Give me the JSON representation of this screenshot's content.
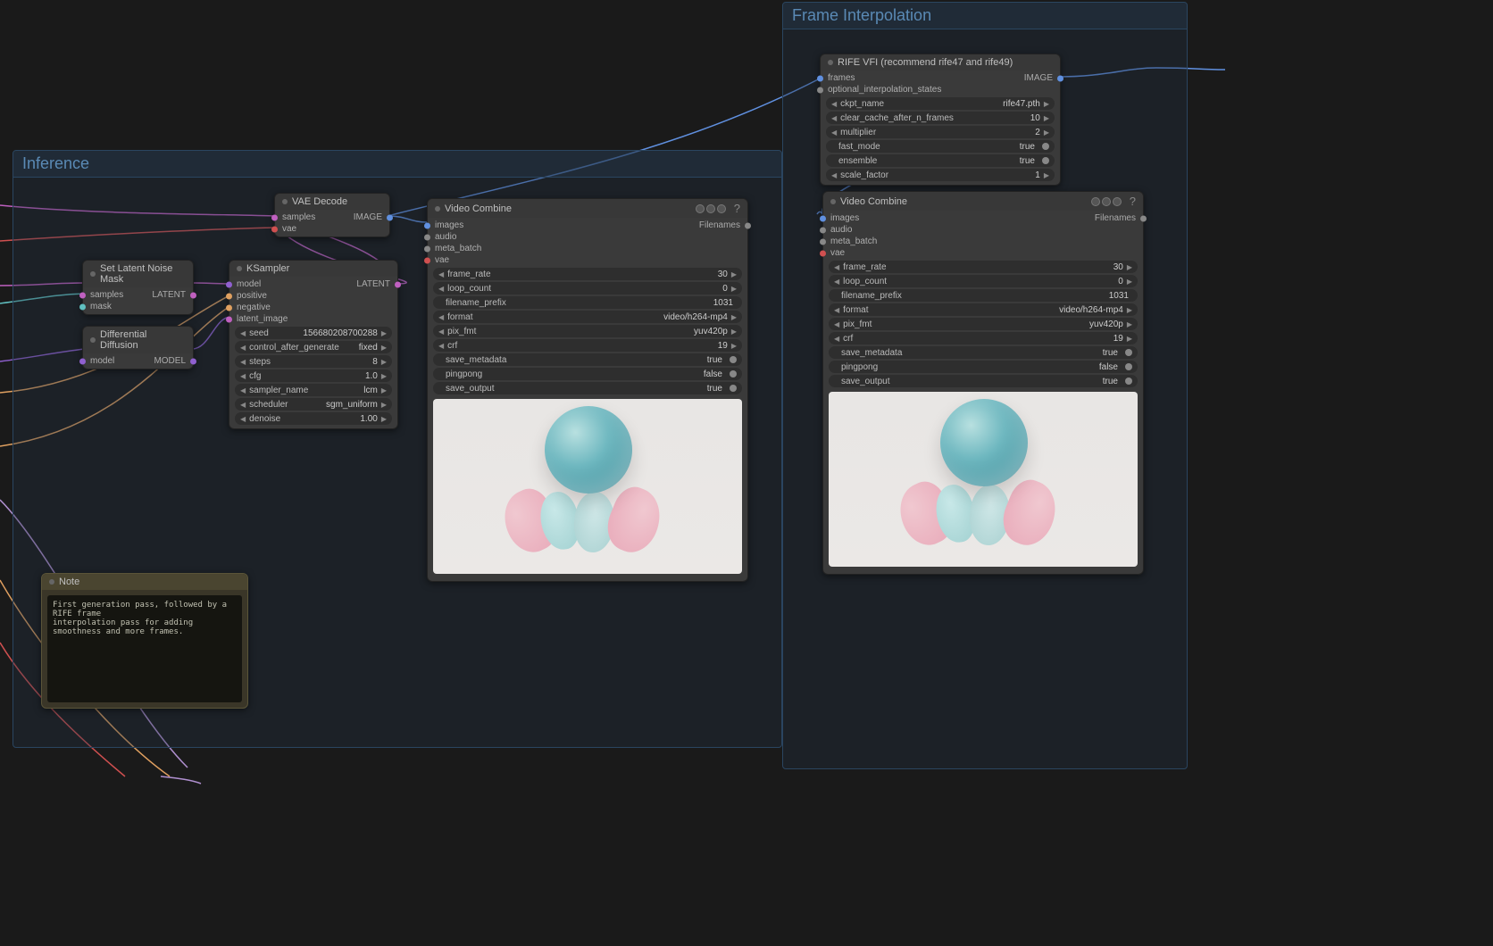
{
  "groups": {
    "inference": {
      "title": "Inference"
    },
    "frame_interp": {
      "title": "Frame Interpolation"
    }
  },
  "nodes": {
    "vae_decode": {
      "title": "VAE Decode",
      "in": [
        "samples",
        "vae"
      ],
      "out": "IMAGE"
    },
    "latent_mask": {
      "title": "Set Latent Noise Mask",
      "in": [
        "samples",
        "mask"
      ],
      "out": "LATENT"
    },
    "diff_diffusion": {
      "title": "Differential Diffusion",
      "in": [
        "model"
      ],
      "out": "MODEL"
    },
    "ksampler": {
      "title": "KSampler",
      "in": [
        "model",
        "positive",
        "negative",
        "latent_image"
      ],
      "out": "LATENT",
      "widgets": {
        "seed": "156680208700288",
        "control_after_generate": "fixed",
        "steps": "8",
        "cfg": "1.0",
        "sampler_name": "lcm",
        "scheduler": "sgm_uniform",
        "denoise": "1.00"
      }
    },
    "video_combine_1": {
      "title": "Video Combine",
      "in": [
        "images",
        "audio",
        "meta_batch",
        "vae"
      ],
      "out": "Filenames",
      "widgets": {
        "frame_rate": "30",
        "loop_count": "0",
        "filename_prefix": "1031",
        "format": "video/h264-mp4",
        "pix_fmt": "yuv420p",
        "crf": "19",
        "save_metadata": "true",
        "pingpong": "false",
        "save_output": "true"
      }
    },
    "rife": {
      "title": "RIFE VFI (recommend rife47 and rife49)",
      "in": [
        "frames",
        "optional_interpolation_states"
      ],
      "out": "IMAGE",
      "widgets": {
        "ckpt_name": "rife47.pth",
        "clear_cache_after_n_frames": "10",
        "multiplier": "2",
        "fast_mode": "true",
        "ensemble": "true",
        "scale_factor": "1"
      }
    },
    "video_combine_2": {
      "title": "Video Combine",
      "in": [
        "images",
        "audio",
        "meta_batch",
        "vae"
      ],
      "out": "Filenames",
      "widgets": {
        "frame_rate": "30",
        "loop_count": "0",
        "filename_prefix": "1031",
        "format": "video/h264-mp4",
        "pix_fmt": "yuv420p",
        "crf": "19",
        "save_metadata": "true",
        "pingpong": "false",
        "save_output": "true"
      }
    },
    "note": {
      "title": "Note",
      "text": "First generation pass, followed by a RIFE frame\ninterpolation pass for adding smoothness and more frames."
    }
  },
  "chart_data": null
}
